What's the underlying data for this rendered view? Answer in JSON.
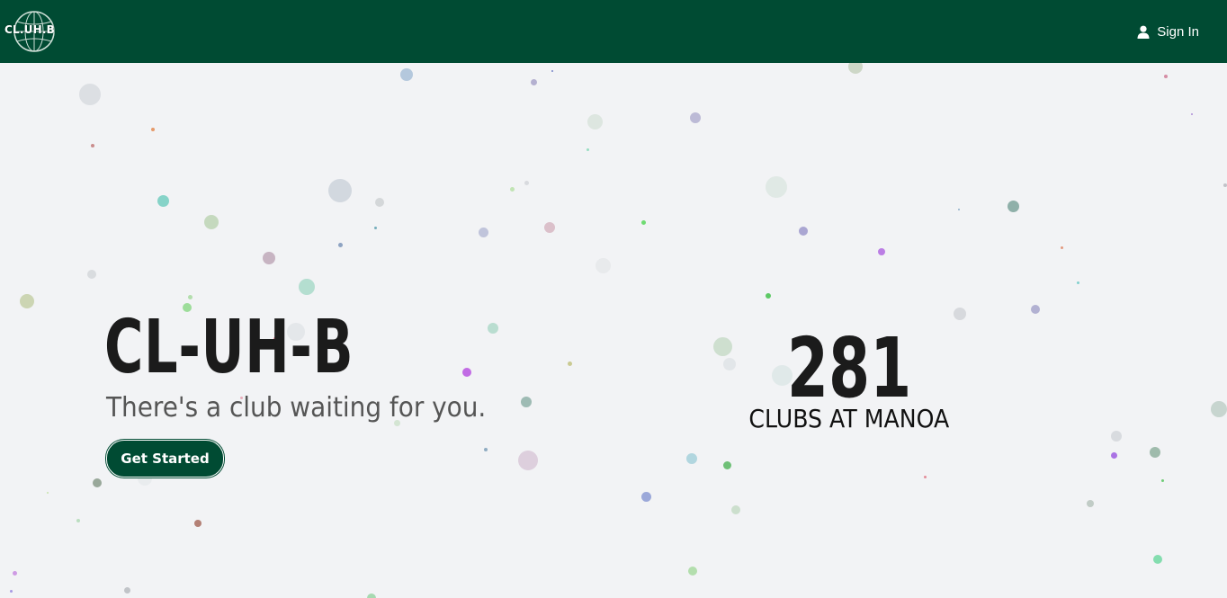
{
  "navbar": {
    "logo_text": "CL.UH.B",
    "sign_in_label": "Sign In",
    "sign_in_icon": "user-icon",
    "background_color": "#004b33"
  },
  "hero": {
    "title": "CL-UH-B",
    "subtitle": "There's a club waiting for you.",
    "cta_label": "Get Started"
  },
  "stats": {
    "count": "281",
    "label": "CLUBS AT MANOA"
  }
}
